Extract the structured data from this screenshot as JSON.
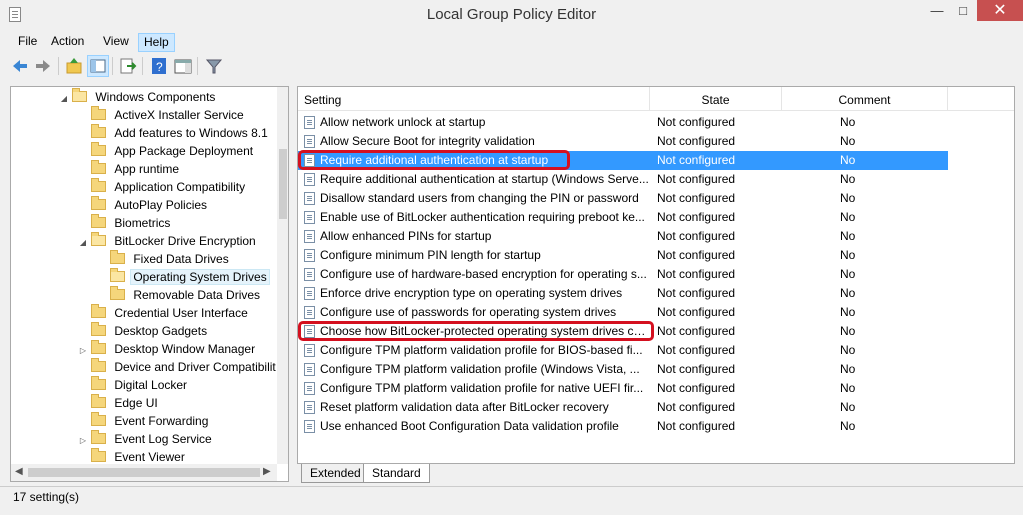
{
  "window": {
    "title": "Local Group Policy Editor",
    "minimize_glyph": "—",
    "maximize_glyph": "□",
    "close_glyph": "✕"
  },
  "menu": [
    "File",
    "Action",
    "View",
    "Help"
  ],
  "toolbar": {
    "icons": [
      "back-arrow-icon",
      "forward-arrow-icon",
      "up-folder-icon",
      "show-hide-tree-icon",
      "export-list-icon",
      "help-icon",
      "show-hide-action-pane-icon",
      "filter-icon"
    ]
  },
  "tree": {
    "items": [
      {
        "label": "Windows Components",
        "expander": "◢"
      },
      {
        "label": "ActiveX Installer Service"
      },
      {
        "label": "Add features to Windows 8.1"
      },
      {
        "label": "App Package Deployment"
      },
      {
        "label": "App runtime"
      },
      {
        "label": "Application Compatibility"
      },
      {
        "label": "AutoPlay Policies"
      },
      {
        "label": "Biometrics"
      },
      {
        "label": "BitLocker Drive Encryption",
        "expander": "◢"
      },
      {
        "label": "Fixed Data Drives"
      },
      {
        "label": "Operating System Drives"
      },
      {
        "label": "Removable Data Drives"
      },
      {
        "label": "Credential User Interface"
      },
      {
        "label": "Desktop Gadgets"
      },
      {
        "label": "Desktop Window Manager",
        "expander": "▷"
      },
      {
        "label": "Device and Driver Compatibilit"
      },
      {
        "label": "Digital Locker"
      },
      {
        "label": "Edge UI"
      },
      {
        "label": "Event Forwarding"
      },
      {
        "label": "Event Log Service",
        "expander": "▷"
      },
      {
        "label": "Event Viewer"
      }
    ]
  },
  "list": {
    "columns": {
      "setting": "Setting",
      "state": "State",
      "comment": "Comment"
    },
    "rows": [
      {
        "setting": "Allow network unlock at startup",
        "state": "Not configured",
        "comment": "No"
      },
      {
        "setting": "Allow Secure Boot for integrity validation",
        "state": "Not configured",
        "comment": "No"
      },
      {
        "setting": "Require additional authentication at startup",
        "state": "Not configured",
        "comment": "No"
      },
      {
        "setting": "Require additional authentication at startup (Windows Serve...",
        "state": "Not configured",
        "comment": "No"
      },
      {
        "setting": "Disallow standard users from changing the PIN or password",
        "state": "Not configured",
        "comment": "No"
      },
      {
        "setting": "Enable use of BitLocker authentication requiring preboot ke...",
        "state": "Not configured",
        "comment": "No"
      },
      {
        "setting": "Allow enhanced PINs for startup",
        "state": "Not configured",
        "comment": "No"
      },
      {
        "setting": "Configure minimum PIN length for startup",
        "state": "Not configured",
        "comment": "No"
      },
      {
        "setting": "Configure use of hardware-based encryption for operating s...",
        "state": "Not configured",
        "comment": "No"
      },
      {
        "setting": "Enforce drive encryption type on operating system drives",
        "state": "Not configured",
        "comment": "No"
      },
      {
        "setting": "Configure use of passwords for operating system drives",
        "state": "Not configured",
        "comment": "No"
      },
      {
        "setting": "Choose how BitLocker-protected operating system drives ca...",
        "state": "Not configured",
        "comment": "No"
      },
      {
        "setting": "Configure TPM platform validation profile for BIOS-based fi...",
        "state": "Not configured",
        "comment": "No"
      },
      {
        "setting": "Configure TPM platform validation profile (Windows Vista, ...",
        "state": "Not configured",
        "comment": "No"
      },
      {
        "setting": "Configure TPM platform validation profile for native UEFI fir...",
        "state": "Not configured",
        "comment": "No"
      },
      {
        "setting": "Reset platform validation data after BitLocker recovery",
        "state": "Not configured",
        "comment": "No"
      },
      {
        "setting": "Use enhanced Boot Configuration Data validation profile",
        "state": "Not configured",
        "comment": "No"
      }
    ]
  },
  "tabs": [
    "Extended",
    "Standard"
  ],
  "status": "17 setting(s)",
  "colors": {
    "selection": "#3399ff",
    "annotation": "#d4101f",
    "close_button": "#c75050"
  }
}
